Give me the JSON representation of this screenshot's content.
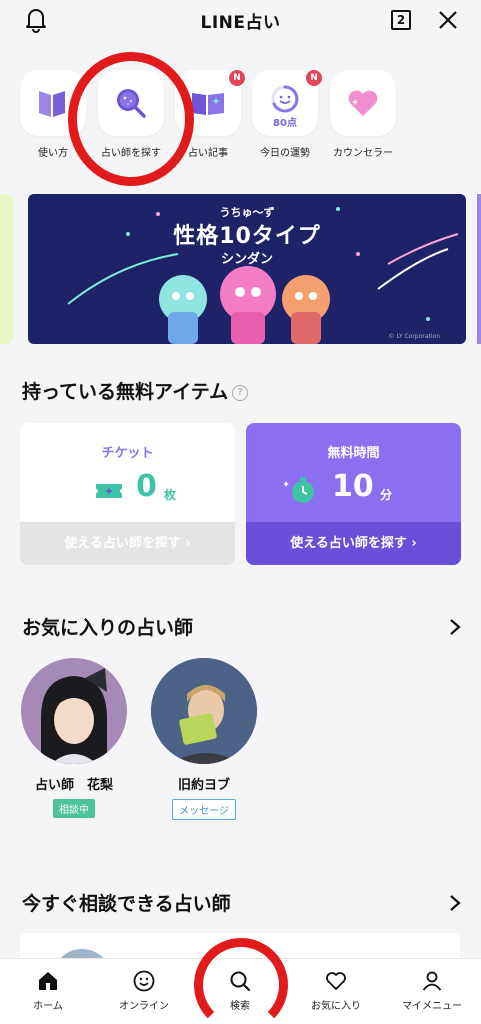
{
  "header": {
    "title": "LINE占い",
    "tab_count": "2"
  },
  "quick_menu": [
    {
      "label": "使い方",
      "icon": "book-icon"
    },
    {
      "label": "占い師を探す",
      "icon": "crystal-search-icon"
    },
    {
      "label": "占い記事",
      "icon": "magazine-icon",
      "badge": "N"
    },
    {
      "label": "今日の運勢",
      "icon": "smile-ring-icon",
      "badge": "N",
      "points": "80点"
    },
    {
      "label": "カウンセラー",
      "icon": "heart-icon"
    }
  ],
  "banner": {
    "subtitle": "うちゅ〜ず",
    "title": "性格10タイプ",
    "title2": "シンダン",
    "copyright": "© LY Corporation"
  },
  "free_items": {
    "title": "持っている無料アイテム",
    "help": "?",
    "ticket": {
      "label": "チケット",
      "value": "0",
      "unit": "枚",
      "button": "使える占い師を探す ›"
    },
    "time": {
      "label": "無料時間",
      "value": "10",
      "unit": "分",
      "button": "使える占い師を探す ›"
    }
  },
  "favorites": {
    "title": "お気に入りの占い師",
    "items": [
      {
        "name": "占い師　花梨",
        "tag": "相談中"
      },
      {
        "name": "旧約ヨブ",
        "tag": "メッセージ"
      }
    ]
  },
  "available_now": {
    "title": "今すぐ相談できる占い師"
  },
  "bottom_nav": [
    {
      "label": "ホーム",
      "icon": "home-icon"
    },
    {
      "label": "オンライン",
      "icon": "smile-icon"
    },
    {
      "label": "検索",
      "icon": "search-icon"
    },
    {
      "label": "お気に入り",
      "icon": "heart-outline-icon"
    },
    {
      "label": "マイメニュー",
      "icon": "person-icon"
    }
  ],
  "colors": {
    "accent_purple": "#8c6ff0",
    "ticket_teal": "#3fc3a6",
    "status_green": "#4cc39b",
    "annotation_red": "#e11b1b"
  }
}
